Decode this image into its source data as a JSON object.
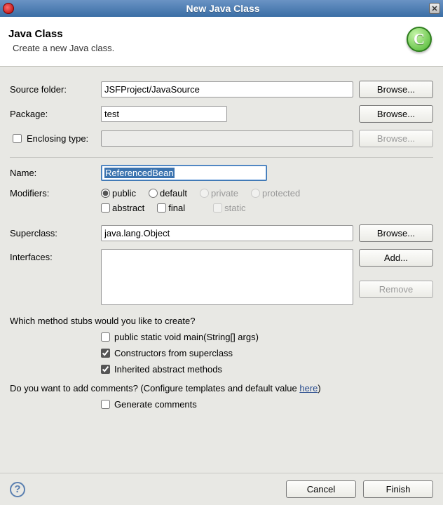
{
  "window": {
    "title": "New Java Class"
  },
  "header": {
    "heading": "Java Class",
    "sub": "Create a new Java class.",
    "logo_letter": "C"
  },
  "labels": {
    "source_folder": "Source folder:",
    "package": "Package:",
    "enclosing_type": "Enclosing type:",
    "name": "Name:",
    "modifiers": "Modifiers:",
    "superclass": "Superclass:",
    "interfaces": "Interfaces:"
  },
  "fields": {
    "source_folder": "JSFProject/JavaSource",
    "package": "test",
    "enclosing_type": "",
    "name": "ReferencedBean",
    "superclass": "java.lang.Object",
    "interfaces": ""
  },
  "buttons": {
    "browse": "Browse...",
    "add": "Add...",
    "remove": "Remove",
    "cancel": "Cancel",
    "finish": "Finish"
  },
  "modifiers": {
    "radio": {
      "public": "public",
      "default": "default",
      "private": "private",
      "protected": "protected"
    },
    "checks": {
      "abstract": "abstract",
      "final": "final",
      "static": "static"
    }
  },
  "stubs": {
    "question": "Which method stubs would you like to create?",
    "main": "public static void main(String[] args)",
    "constructors": "Constructors from superclass",
    "inherited": "Inherited abstract methods"
  },
  "comments": {
    "question_pre": "Do you want to add comments? (Configure templates and default value ",
    "link": "here",
    "question_post": ")",
    "generate": "Generate comments"
  }
}
